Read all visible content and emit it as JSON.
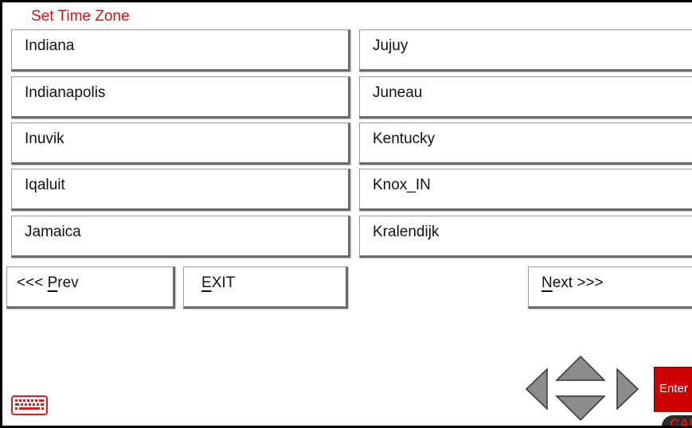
{
  "title": "Set Time Zone",
  "zones_left": [
    "Indiana",
    "Indianapolis",
    "Inuvik",
    "Iqaluit",
    "Jamaica"
  ],
  "zones_right": [
    "Jujuy",
    "Juneau",
    "Kentucky",
    "Knox_IN",
    "Kralendijk"
  ],
  "nav": {
    "prev_prefix": "<<< ",
    "prev_hotkey": "P",
    "prev_rest": "rev",
    "exit_prefix": "",
    "exit_hotkey": "E",
    "exit_rest": "XIT",
    "next_prefix": "",
    "next_hotkey": "N",
    "next_rest": "ext >>>"
  },
  "keypad": {
    "enter_label": "Enter",
    "cancel_label": "CAN"
  },
  "icons": {
    "keyboard": "keyboard-icon",
    "left": "arrow-left-icon",
    "up": "arrow-up-icon",
    "down": "arrow-down-icon",
    "right": "arrow-right-icon"
  },
  "colors": {
    "title": "#e01010",
    "enter_bg": "#cc0000",
    "keyboard_icon": "#d42020",
    "arrow_fill": "#8c8c8c"
  }
}
